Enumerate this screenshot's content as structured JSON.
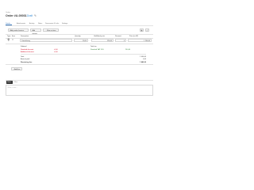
{
  "header": {
    "breadcrumb": "Orders",
    "title": "Order #U-00031",
    "status": "Draft"
  },
  "tabs": [
    "Details",
    "Attachments",
    "Activity",
    "Notes",
    "Documents & Links",
    "Settings"
  ],
  "toolbar": {
    "add_product": "Add product/service",
    "add_section": "Add section",
    "more": "More actions"
  },
  "table": {
    "headers": [
      "Type",
      "Item",
      "Description",
      "Quantity",
      "Unit/Hourly rate",
      "Discount",
      "Price (in HT)"
    ],
    "item_row": {
      "description": "Consultancy",
      "quantity": "10,00",
      "rate": "120,00",
      "discount": "0",
      "price": "1 200,00"
    }
  },
  "summary": {
    "left_title": "Subtotal",
    "left_rows": [
      {
        "label": "Standard discount",
        "value": "-0,00"
      },
      {
        "label": "Additional discount",
        "value": "-0,00"
      }
    ],
    "right_title": "Total tax",
    "right_rows": [
      {
        "label": "Standard VAT 20%",
        "value": "240,00"
      }
    ],
    "lines": [
      {
        "label": "Total",
        "value": "1 440,00"
      },
      {
        "label": "Amount paid",
        "value": "0,00"
      },
      {
        "label": "Remaining due",
        "value": "1 440,00"
      }
    ]
  },
  "add_line": "Add line",
  "comments": {
    "tab_active": "Notes",
    "tab_other": "Files",
    "placeholder": "Write a note..."
  }
}
